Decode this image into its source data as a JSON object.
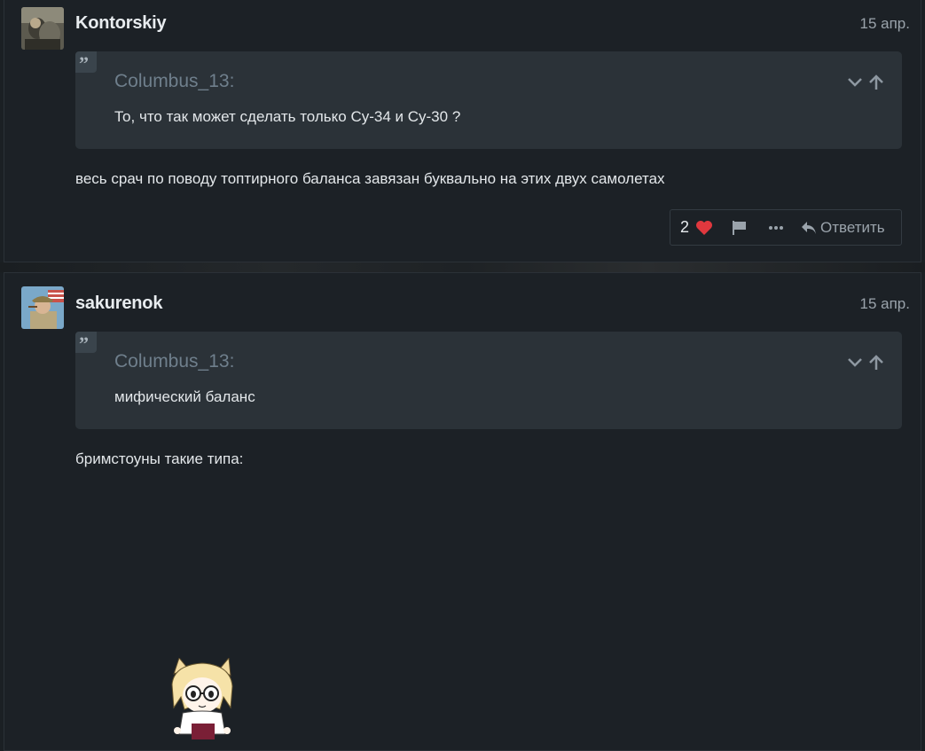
{
  "posts": [
    {
      "username": "Kontorskiy",
      "date": "15 апр.",
      "quote": {
        "author": "Columbus_13:",
        "text": "То, что так может сделать только Су-34 и Су-30 ?"
      },
      "body": "весь срач по поводу топтирного баланса завязан буквально на этих двух самолетах",
      "actions": {
        "like_count": "2",
        "reply_label": "Ответить"
      }
    },
    {
      "username": "sakurenok",
      "date": "15 апр.",
      "quote": {
        "author": "Columbus_13:",
        "text": "мифический баланс"
      },
      "body": "бримстоуны такие типа:"
    }
  ],
  "colors": {
    "heart": "#e0383e",
    "background": "#1b2024",
    "quote_bg": "#2b3238"
  },
  "icons": [
    "quote-icon",
    "chevron-down-icon",
    "arrow-up-icon",
    "heart-icon",
    "flag-icon",
    "more-icon",
    "reply-icon"
  ]
}
